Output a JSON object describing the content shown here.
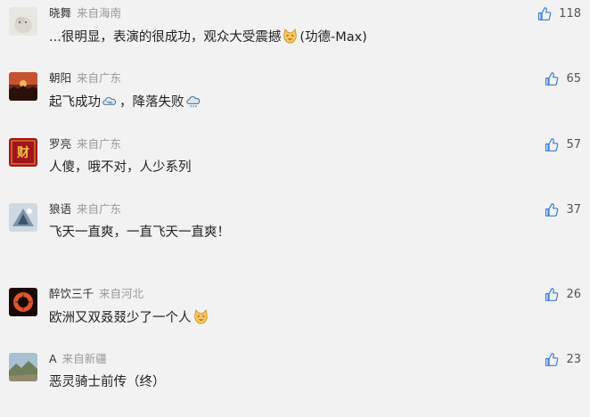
{
  "comments": [
    {
      "name": "晓舞",
      "location": "来自海南",
      "likes": "118",
      "text_before": "...很明显，表演的很成功，观众大受震撼",
      "emoji_mid": "cat-emoji",
      "text_after": "(功德-Max)"
    },
    {
      "name": "朝阳",
      "location": "来自广东",
      "likes": "65",
      "text_before": "起飞成功",
      "emoji_mid": "cloud-emoji",
      "text_after": "，降落失败",
      "emoji_end": "cloud-emoji"
    },
    {
      "name": "罗亮",
      "location": "来自广东",
      "likes": "57",
      "text_before": "人傻，哦不对，人少系列",
      "avatar_text": "财"
    },
    {
      "name": "狼语",
      "location": "来自广东",
      "likes": "37",
      "text_before": "飞天一直爽，一直飞天一直爽！"
    },
    {
      "name": "醉饮三千",
      "location": "来自河北",
      "likes": "26",
      "text_before": "欧洲又双叒叕少了一个人",
      "emoji_end": "cat-emoji"
    },
    {
      "name": "A",
      "location": "来自新疆",
      "likes": "23",
      "text_before": "恶灵骑士前传（终）"
    }
  ]
}
